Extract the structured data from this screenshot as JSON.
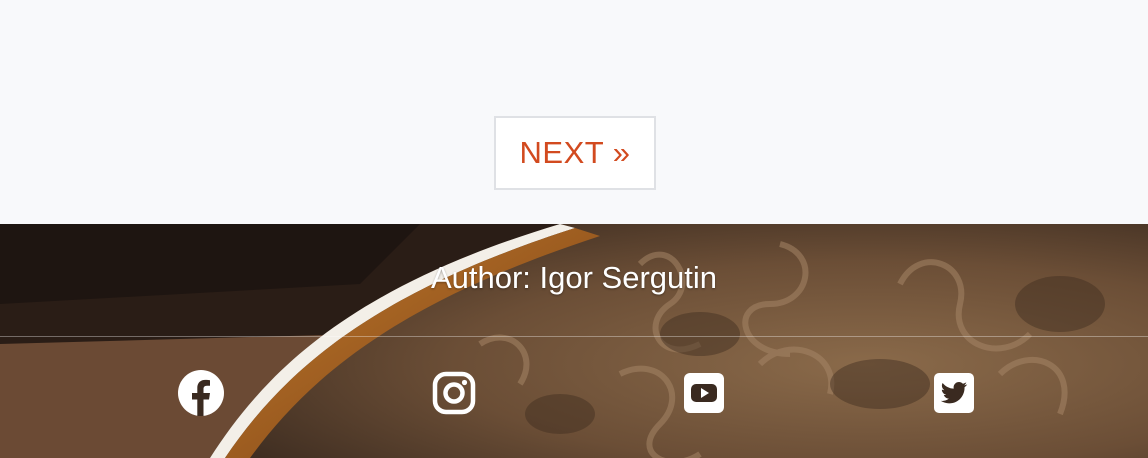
{
  "pagination": {
    "next_label": "NEXT »"
  },
  "footer": {
    "author_text": "Author: Igor Sergutin",
    "social_links": [
      {
        "icon": "facebook-icon",
        "label": "Facebook"
      },
      {
        "icon": "instagram-icon",
        "label": "Instagram"
      },
      {
        "icon": "youtube-icon",
        "label": "YouTube"
      },
      {
        "icon": "twitter-icon",
        "label": "Twitter"
      }
    ]
  },
  "colors": {
    "page_background": "#f8f9fb",
    "accent": "#d24a1f",
    "button_border": "#dfe1e5",
    "footer_text": "#ffffff"
  }
}
